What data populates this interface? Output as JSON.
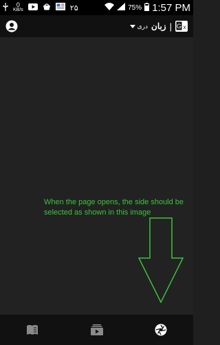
{
  "status_bar": {
    "net_speed_value": "0",
    "net_speed_unit": "KB/s",
    "day_number": "۲۵",
    "battery_percent": "75%",
    "time": "1:57 PM"
  },
  "app_bar": {
    "language_value": "دری",
    "language_label": "زبان",
    "separator": "|"
  },
  "annotation": {
    "text": "When the page opens, the side should be selected as shown in this image",
    "color": "#3cc33c"
  },
  "bottom_nav": {
    "items": [
      {
        "icon": "book-icon",
        "selected": false
      },
      {
        "icon": "video-library-icon",
        "selected": false
      },
      {
        "icon": "camera-shutter-icon",
        "selected": true
      }
    ]
  }
}
